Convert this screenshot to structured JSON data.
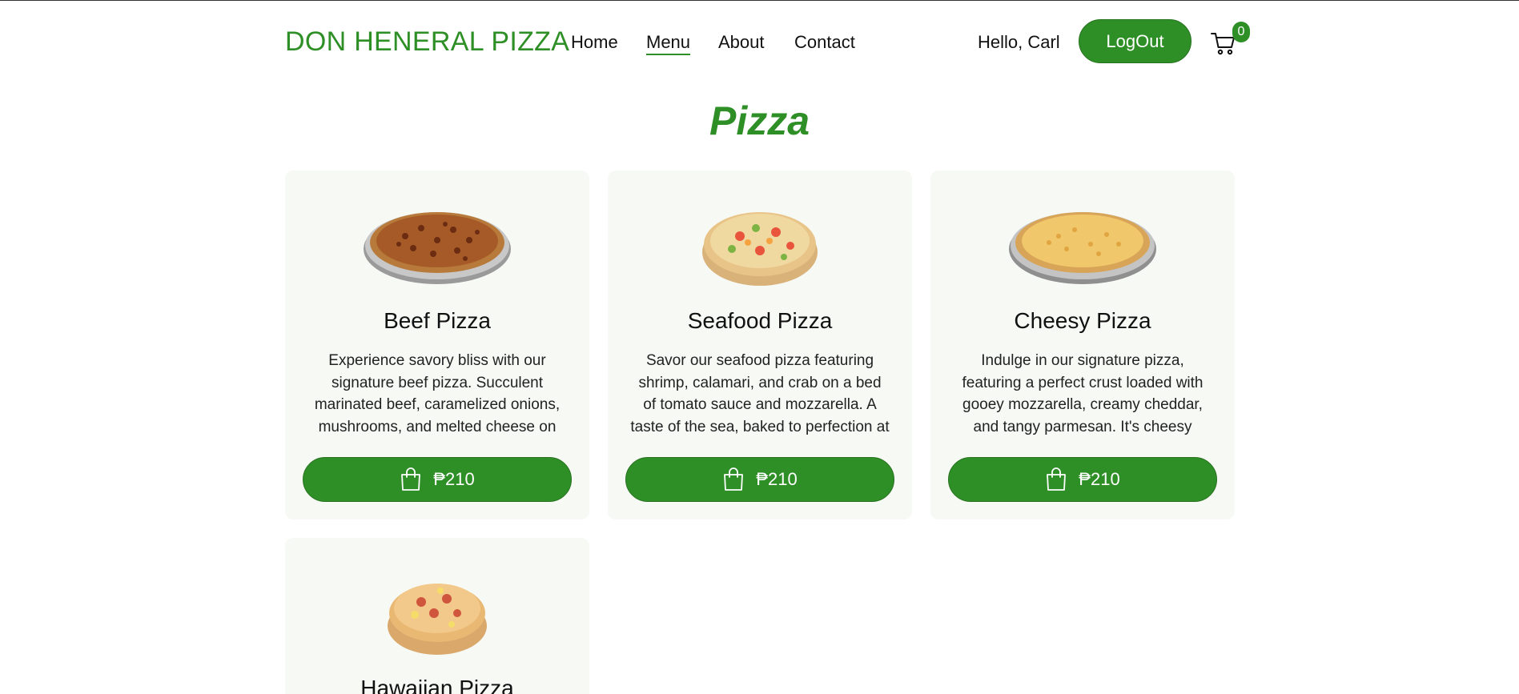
{
  "nav": {
    "brand": "DON HENERAL PIZZA",
    "links": [
      {
        "label": "Home"
      },
      {
        "label": "Menu",
        "active": true
      },
      {
        "label": "About"
      },
      {
        "label": "Contact"
      }
    ],
    "greeting": "Hello, Carl",
    "logout_label": "LogOut",
    "cart_icon": "shopping-cart-icon",
    "cart_count": "0"
  },
  "page": {
    "title": "Pizza"
  },
  "menu": {
    "items": [
      {
        "name": "Beef Pizza",
        "description": "Experience savory bliss with our signature beef pizza. Succulent marinated beef, caramelized onions, mushrooms, and melted cheese on a...",
        "price": "₱210",
        "icon": "shopping-bag-icon"
      },
      {
        "name": "Seafood Pizza",
        "description": "Savor our seafood pizza featuring shrimp, calamari, and crab on a bed of tomato sauce and mozzarella. A taste of the sea, baked to perfection at Don..",
        "price": "₱210",
        "icon": "shopping-bag-icon"
      },
      {
        "name": "Cheesy Pizza",
        "description": "Indulge in our signature pizza, featuring a perfect crust loaded with gooey mozzarella, creamy cheddar, and tangy parmesan. It's cheesy perfectio...",
        "price": "₱210",
        "icon": "shopping-bag-icon"
      },
      {
        "name": "Hawaiian Pizza",
        "description": "",
        "price": "",
        "icon": "shopping-bag-icon"
      }
    ]
  },
  "colors": {
    "brand_green": "#2f8f27",
    "card_bg": "#f7f9f5"
  }
}
